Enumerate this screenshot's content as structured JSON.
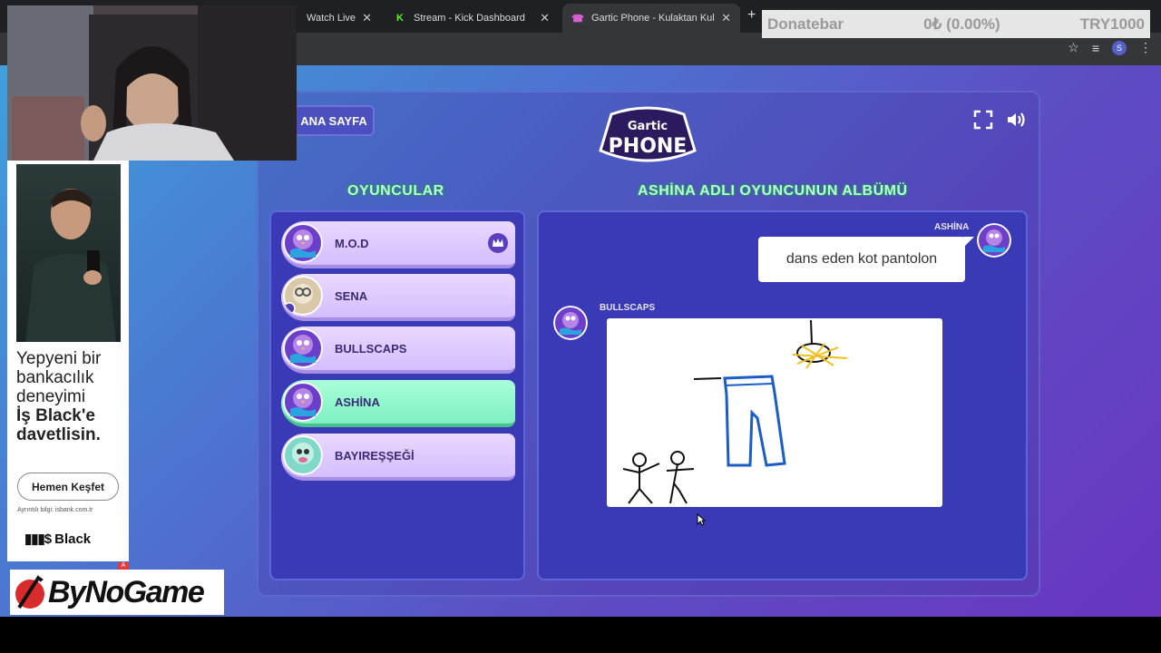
{
  "browser": {
    "tabs": [
      {
        "title": "Watch Live o",
        "icon": ""
      },
      {
        "title": "Stream - Kick Dashboard",
        "icon": "K"
      },
      {
        "title": "Gartic Phone - Kulaktan Kul",
        "icon": "☎"
      }
    ],
    "new_tab": "+",
    "profile_initial": "S"
  },
  "donatebar": {
    "label": "Donatebar",
    "amount": "0₺ (0.00%)",
    "goal": "TRY1000"
  },
  "game": {
    "home_button": "ANA SAYFA",
    "logo_top": "Gartic",
    "logo_main": "PHONE",
    "players_heading": "OYUNCULAR",
    "album_heading": "ASHİNA ADLI OYUNCUNUN ALBÜMÜ",
    "players": [
      {
        "name": "M.O.D",
        "host": true,
        "active": false
      },
      {
        "name": "SENA",
        "host": false,
        "active": false
      },
      {
        "name": "BULLSCAPS",
        "host": false,
        "active": false
      },
      {
        "name": "ASHİNA",
        "host": false,
        "active": true
      },
      {
        "name": "BAYIREŞŞEĞİ",
        "host": false,
        "active": false
      }
    ],
    "album": {
      "prompt_author": "ASHİNA",
      "prompt_text": "dans eden kot pantolon",
      "drawing_author": "BULLSCAPS"
    }
  },
  "ad": {
    "line1": "Yepyeni bir",
    "line2": "bankacılık",
    "line3": "deneyimi",
    "line4": "İş Black'e",
    "line5": "davetlisin.",
    "button": "Hemen Keşfet",
    "small": "Ayrıntılı bilgi: isbank.com.tr",
    "brand": "Black",
    "corner": "A"
  },
  "sponsor": {
    "name": "ByNoGame"
  }
}
